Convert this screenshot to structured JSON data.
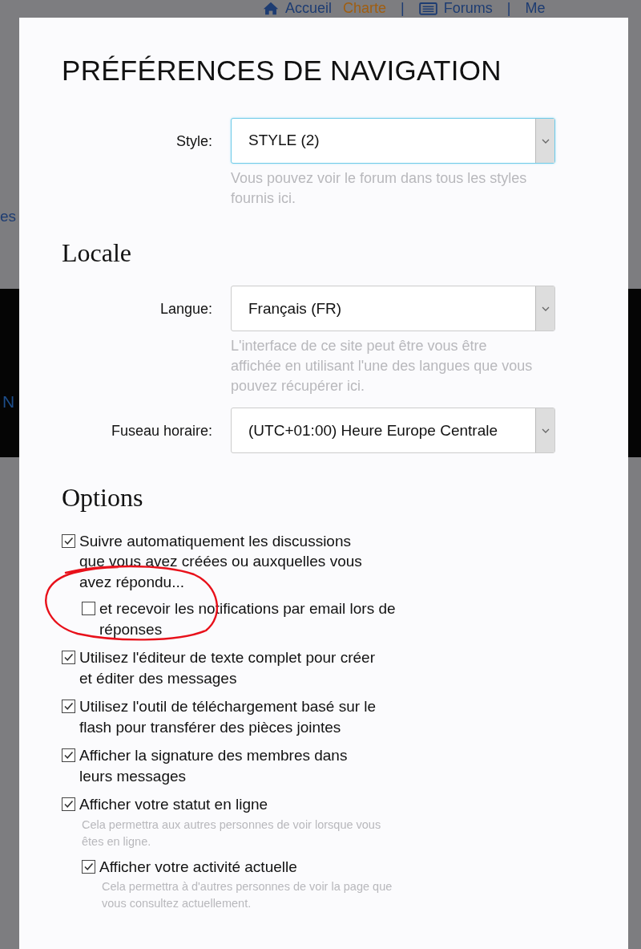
{
  "background_page": {
    "nav": [
      {
        "kind": "home",
        "label": "Accueil"
      },
      {
        "kind": "active",
        "label": "Charte"
      },
      {
        "kind": "separator",
        "label": "|"
      },
      {
        "kind": "forums",
        "label": "Forums"
      },
      {
        "kind": "separator",
        "label": "|"
      },
      {
        "kind": "link",
        "label": "Me"
      }
    ],
    "fragments": [
      {
        "kind": "text",
        "label": "es"
      },
      {
        "kind": "band",
        "label": "N"
      }
    ]
  },
  "modal": {
    "title": "PRÉFÉRENCES DE NAVIGATION",
    "style_field": {
      "label": "Style:",
      "value": "STYLE (2)",
      "focused": true,
      "hint": "Vous pouvez voir le forum dans tous les styles fournis ici."
    },
    "locale": {
      "heading": "Locale",
      "fields": [
        {
          "label": "Langue:",
          "value": "Français (FR)",
          "focused": false,
          "hint": "L'interface de ce site peut être vous être affichée en utilisant l'une des langues que vous pouvez récupérer ici."
        },
        {
          "label": "Fuseau horaire:",
          "value": "(UTC+01:00) Heure Europe Centrale",
          "focused": false
        }
      ]
    },
    "options": {
      "heading": "Options",
      "items": [
        {
          "label": "Suivre automatiquement les discussions que vous avez créées ou auxquelles vous avez répondu...",
          "checked": true,
          "children": [
            {
              "label": "et recevoir les notifications par email lors de réponses",
              "checked": false
            }
          ]
        },
        {
          "label": "Utilisez l'éditeur de texte complet pour créer et éditer des messages",
          "checked": true
        },
        {
          "label": "Utilisez l'outil de téléchargement basé sur le flash pour transférer des pièces jointes",
          "checked": true
        },
        {
          "label": "Afficher la signature des membres dans leurs messages",
          "checked": true
        },
        {
          "label": "Afficher votre statut en ligne",
          "checked": true,
          "hint": "Cela permettra aux autres personnes de voir lorsque vous êtes en ligne.",
          "children": [
            {
              "label": "Afficher votre activité actuelle",
              "checked": true,
              "hint": "Cela permettra à d'autres personnes de voir la page que vous consultez actuellement."
            }
          ]
        }
      ]
    }
  }
}
